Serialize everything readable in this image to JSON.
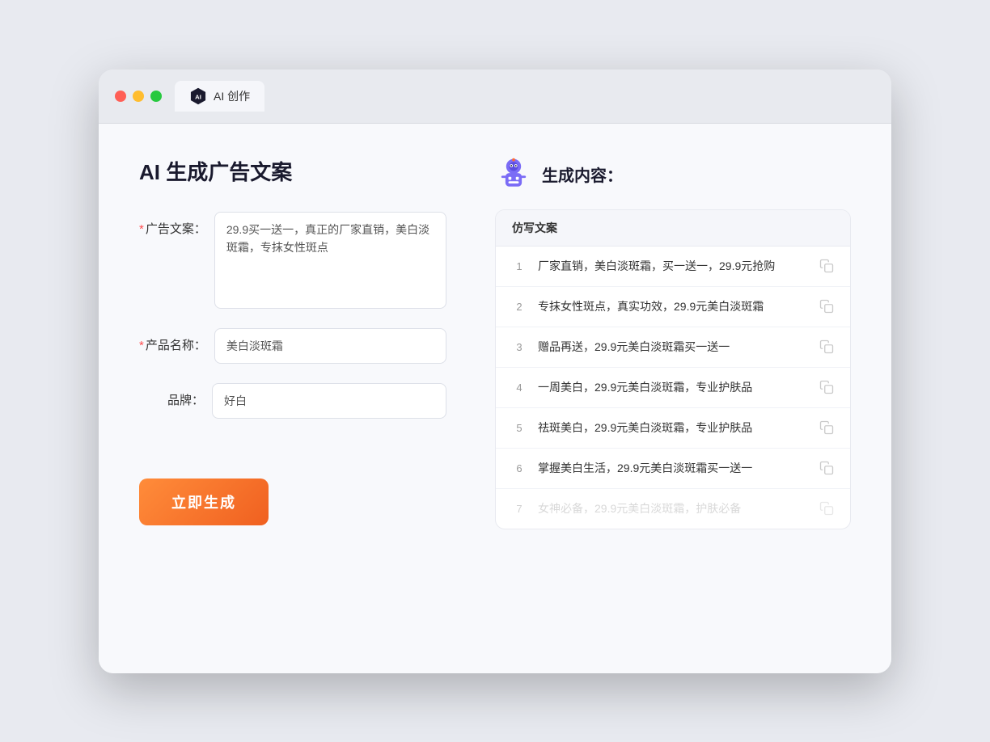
{
  "browser": {
    "tab_label": "AI 创作",
    "traffic_lights": [
      "red",
      "yellow",
      "green"
    ]
  },
  "left_panel": {
    "page_title": "AI 生成广告文案",
    "form": {
      "ad_copy_label": "广告文案：",
      "ad_copy_required": "*",
      "ad_copy_value": "29.9买一送一，真正的厂家直销，美白淡斑霜，专抹女性斑点",
      "product_name_label": "产品名称：",
      "product_name_required": "*",
      "product_name_value": "美白淡斑霜",
      "brand_label": "品牌：",
      "brand_value": "好白"
    },
    "generate_button": "立即生成"
  },
  "right_panel": {
    "title": "生成内容：",
    "table_header": "仿写文案",
    "results": [
      {
        "num": "1",
        "text": "厂家直销，美白淡斑霜，买一送一，29.9元抢购"
      },
      {
        "num": "2",
        "text": "专抹女性斑点，真实功效，29.9元美白淡斑霜"
      },
      {
        "num": "3",
        "text": "赠品再送，29.9元美白淡斑霜买一送一"
      },
      {
        "num": "4",
        "text": "一周美白，29.9元美白淡斑霜，专业护肤品"
      },
      {
        "num": "5",
        "text": "祛斑美白，29.9元美白淡斑霜，专业护肤品"
      },
      {
        "num": "6",
        "text": "掌握美白生活，29.9元美白淡斑霜买一送一"
      },
      {
        "num": "7",
        "text": "女神必备，29.9元美白淡斑霜，护肤必备",
        "faded": true
      }
    ]
  }
}
